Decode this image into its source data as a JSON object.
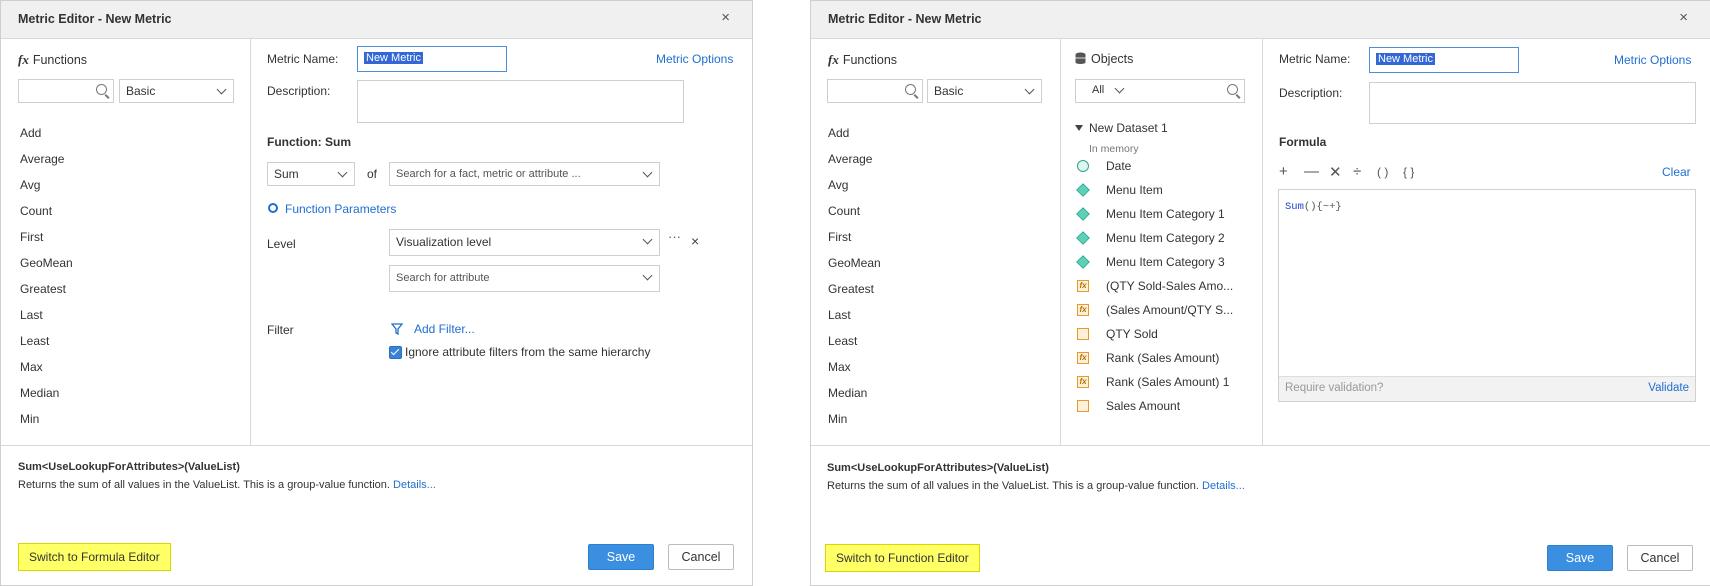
{
  "dialog1": {
    "title": "Metric Editor - New Metric",
    "functions_header": "Functions",
    "category": "Basic",
    "functions": [
      "Add",
      "Average",
      "Avg",
      "Count",
      "First",
      "GeoMean",
      "Greatest",
      "Last",
      "Least",
      "Max",
      "Median",
      "Min"
    ],
    "metric_name_label": "Metric Name:",
    "metric_name_value": "New Metric",
    "metric_options": "Metric Options",
    "description_label": "Description:",
    "function_heading": "Function: Sum",
    "function_select": "Sum",
    "of_label": "of",
    "of_placeholder": "Search for a fact, metric or attribute ...",
    "function_parameters": "Function Parameters",
    "level_label": "Level",
    "level_value": "Visualization level",
    "level_more": "···",
    "level_remove": "×",
    "attribute_placeholder": "Search for attribute",
    "filter_label": "Filter",
    "add_filter": "Add Filter...",
    "ignore_filters": "Ignore attribute filters from the same hierarchy",
    "signature": "Sum<UseLookupForAttributes>(ValueList)",
    "signature_desc": "Returns the sum of all values in the ValueList. This is a group-value function.",
    "details": "Details...",
    "switch_button": "Switch to Formula Editor",
    "save": "Save",
    "cancel": "Cancel",
    "close": "×"
  },
  "dialog2": {
    "title": "Metric Editor - New Metric",
    "functions_header": "Functions",
    "category": "Basic",
    "functions": [
      "Add",
      "Average",
      "Avg",
      "Count",
      "First",
      "GeoMean",
      "Greatest",
      "Last",
      "Least",
      "Max",
      "Median",
      "Min"
    ],
    "objects_header": "Objects",
    "objects_filter": "All",
    "dataset_name": "New Dataset 1",
    "dataset_sub": "In memory",
    "objects": [
      {
        "name": "Date",
        "icon": "clock-icon"
      },
      {
        "name": "Menu Item",
        "icon": "attribute-icon"
      },
      {
        "name": "Menu Item Category 1",
        "icon": "attribute-icon"
      },
      {
        "name": "Menu Item Category 2",
        "icon": "attribute-icon"
      },
      {
        "name": "Menu Item Category 3",
        "icon": "attribute-icon"
      },
      {
        "name": "(QTY Sold-Sales Amo...",
        "icon": "metric-fx-icon"
      },
      {
        "name": "(Sales Amount/QTY S...",
        "icon": "metric-fx-icon"
      },
      {
        "name": "QTY Sold",
        "icon": "fact-icon"
      },
      {
        "name": "Rank (Sales Amount)",
        "icon": "metric-fx-icon"
      },
      {
        "name": "Rank (Sales Amount) 1",
        "icon": "metric-fx-icon"
      },
      {
        "name": "Sales Amount",
        "icon": "fact-icon"
      }
    ],
    "metric_name_label": "Metric Name:",
    "metric_name_value": "New Metric",
    "metric_options": "Metric Options",
    "description_label": "Description:",
    "formula_heading": "Formula",
    "toolbar": {
      "plus": "+",
      "minus": "—",
      "times": "✕",
      "divide": "÷",
      "parens": "( )",
      "braces": "{ }"
    },
    "clear": "Clear",
    "formula_func": "Sum",
    "formula_rest": "(){~+}",
    "require_validation": "Require validation?",
    "validate": "Validate",
    "signature": "Sum<UseLookupForAttributes>(ValueList)",
    "signature_desc": "Returns the sum of all values in the ValueList. This is a group-value function.",
    "details": "Details...",
    "switch_button": "Switch to Function Editor",
    "save": "Save",
    "cancel": "Cancel",
    "close": "×"
  },
  "colors": {
    "accent": "#1f6fd1",
    "save": "#3b8fe0",
    "highlight": "#ffff66",
    "selection": "#3367d6"
  }
}
